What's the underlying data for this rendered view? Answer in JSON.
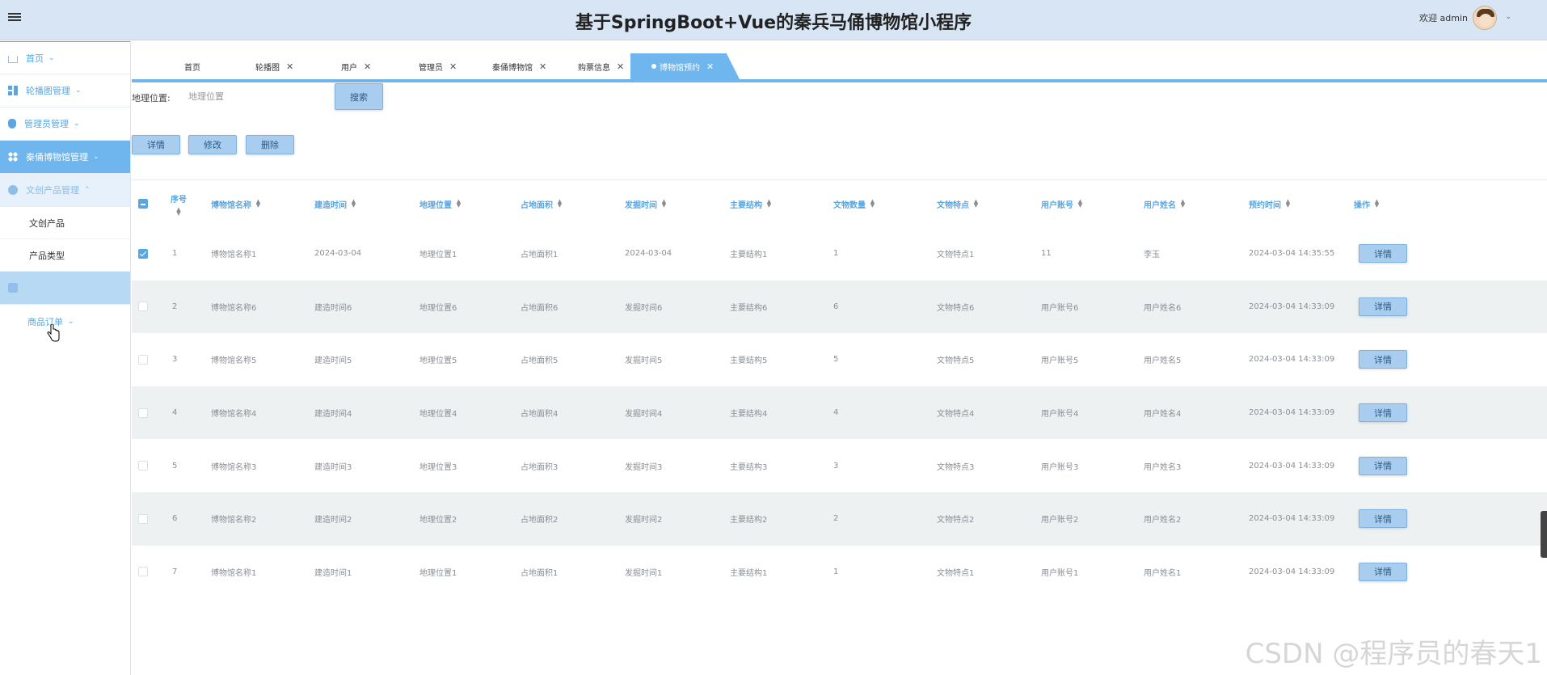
{
  "header": {
    "title": "基于SpringBoot+Vue的秦兵马俑博物馆小程序",
    "welcome": "欢迎 admin"
  },
  "sidebar": {
    "items": [
      {
        "label": "首页",
        "icon": "home-icon"
      },
      {
        "label": "轮播图管理",
        "icon": "grid-icon"
      },
      {
        "label": "管理员管理",
        "icon": "mouse-icon"
      },
      {
        "label": "秦俑博物馆管理",
        "icon": "apps-icon"
      },
      {
        "label": "文创产品管理",
        "icon": "circle-icon"
      }
    ],
    "subitems": [
      "文创产品",
      "产品类型"
    ],
    "hidden_item_icon": "square-icon",
    "order_item": "商品订单"
  },
  "tabs": [
    {
      "label": "首页"
    },
    {
      "label": "轮播图"
    },
    {
      "label": "用户"
    },
    {
      "label": "管理员"
    },
    {
      "label": "秦俑博物馆"
    },
    {
      "label": "购票信息"
    },
    {
      "label": "博物馆预约"
    }
  ],
  "search": {
    "label": "地理位置:",
    "placeholder": "地理位置",
    "button": "搜索"
  },
  "actions": {
    "detail": "详情",
    "edit": "修改",
    "delete": "删除"
  },
  "table": {
    "columns": [
      "序号",
      "博物馆名称",
      "建造时间",
      "地理位置",
      "占地面积",
      "发掘时间",
      "主要结构",
      "文物数量",
      "文物特点",
      "用户账号",
      "用户姓名",
      "预约时间",
      "操作"
    ],
    "rows": [
      {
        "checked": true,
        "cells": [
          "1",
          "博物馆名称1",
          "2024-03-04",
          "地理位置1",
          "占地面积1",
          "2024-03-04",
          "主要结构1",
          "1",
          "文物特点1",
          "11",
          "李玉",
          "2024-03-04 14:35:55"
        ],
        "action": "详情"
      },
      {
        "checked": false,
        "cells": [
          "2",
          "博物馆名称6",
          "建造时间6",
          "地理位置6",
          "占地面积6",
          "发掘时间6",
          "主要结构6",
          "6",
          "文物特点6",
          "用户账号6",
          "用户姓名6",
          "2024-03-04 14:33:09"
        ],
        "action": "详情"
      },
      {
        "checked": false,
        "cells": [
          "3",
          "博物馆名称5",
          "建造时间5",
          "地理位置5",
          "占地面积5",
          "发掘时间5",
          "主要结构5",
          "5",
          "文物特点5",
          "用户账号5",
          "用户姓名5",
          "2024-03-04 14:33:09"
        ],
        "action": "详情"
      },
      {
        "checked": false,
        "cells": [
          "4",
          "博物馆名称4",
          "建造时间4",
          "地理位置4",
          "占地面积4",
          "发掘时间4",
          "主要结构4",
          "4",
          "文物特点4",
          "用户账号4",
          "用户姓名4",
          "2024-03-04 14:33:09"
        ],
        "action": "详情"
      },
      {
        "checked": false,
        "cells": [
          "5",
          "博物馆名称3",
          "建造时间3",
          "地理位置3",
          "占地面积3",
          "发掘时间3",
          "主要结构3",
          "3",
          "文物特点3",
          "用户账号3",
          "用户姓名3",
          "2024-03-04 14:33:09"
        ],
        "action": "详情"
      },
      {
        "checked": false,
        "cells": [
          "6",
          "博物馆名称2",
          "建造时间2",
          "地理位置2",
          "占地面积2",
          "发掘时间2",
          "主要结构2",
          "2",
          "文物特点2",
          "用户账号2",
          "用户姓名2",
          "2024-03-04 14:33:09"
        ],
        "action": "详情"
      },
      {
        "checked": false,
        "cells": [
          "7",
          "博物馆名称1",
          "建造时间1",
          "地理位置1",
          "占地面积1",
          "发掘时间1",
          "主要结构1",
          "1",
          "文物特点1",
          "用户账号1",
          "用户姓名1",
          "2024-03-04 14:33:09"
        ],
        "action": "详情"
      }
    ]
  },
  "watermark": "CSDN @程序员的春天1",
  "colors": {
    "accent": "#6fb5ee",
    "header_bg": "#d7e5f4",
    "stripe": "#eef1f2"
  }
}
